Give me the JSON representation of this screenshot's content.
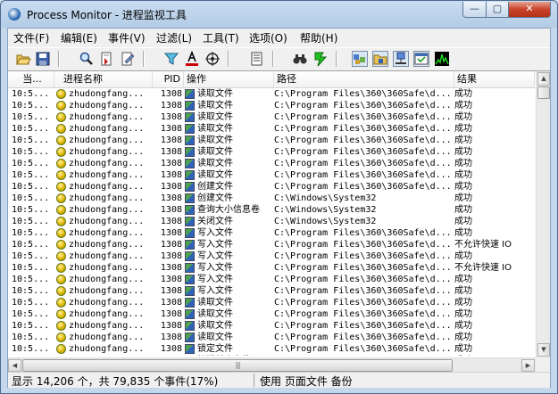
{
  "window": {
    "title": "Process Monitor - 进程监视工具"
  },
  "title_controls": {
    "minimize": "—",
    "maximize": "▢",
    "close": "✕"
  },
  "menu": [
    "文件(F)",
    "编辑(E)",
    "事件(V)",
    "过滤(L)",
    "工具(T)",
    "选项(O)",
    "帮助(H)"
  ],
  "columns": {
    "time": "当...",
    "process": "进程名称",
    "pid": "PID",
    "operation": "操作",
    "path": "路径",
    "result": "结果"
  },
  "rows": [
    {
      "time": "10:5...",
      "process": "zhudongfang...",
      "pid": "1308",
      "op": "读取文件",
      "path": "C:\\Program Files\\360\\360Safe\\d...",
      "result": "成功"
    },
    {
      "time": "10:5...",
      "process": "zhudongfang...",
      "pid": "1308",
      "op": "读取文件",
      "path": "C:\\Program Files\\360\\360Safe\\d...",
      "result": "成功"
    },
    {
      "time": "10:5...",
      "process": "zhudongfang...",
      "pid": "1308",
      "op": "读取文件",
      "path": "C:\\Program Files\\360\\360Safe\\d...",
      "result": "成功"
    },
    {
      "time": "10:5...",
      "process": "zhudongfang...",
      "pid": "1308",
      "op": "读取文件",
      "path": "C:\\Program Files\\360\\360Safe\\d...",
      "result": "成功"
    },
    {
      "time": "10:5...",
      "process": "zhudongfang...",
      "pid": "1308",
      "op": "读取文件",
      "path": "C:\\Program Files\\360\\360Safe\\d...",
      "result": "成功"
    },
    {
      "time": "10:5...",
      "process": "zhudongfang...",
      "pid": "1308",
      "op": "读取文件",
      "path": "C:\\Program Files\\360\\360Safe\\d...",
      "result": "成功"
    },
    {
      "time": "10:5...",
      "process": "zhudongfang...",
      "pid": "1308",
      "op": "读取文件",
      "path": "C:\\Program Files\\360\\360Safe\\d...",
      "result": "成功"
    },
    {
      "time": "10:5...",
      "process": "zhudongfang...",
      "pid": "1308",
      "op": "读取文件",
      "path": "C:\\Program Files\\360\\360Safe\\d...",
      "result": "成功"
    },
    {
      "time": "10:5...",
      "process": "zhudongfang...",
      "pid": "1308",
      "op": "创建文件",
      "path": "C:\\Program Files\\360\\360Safe\\d...",
      "result": "成功"
    },
    {
      "time": "10:5...",
      "process": "zhudongfang...",
      "pid": "1308",
      "op": "创建文件",
      "path": "C:\\Windows\\System32",
      "result": "成功"
    },
    {
      "time": "10:5...",
      "process": "zhudongfang...",
      "pid": "1308",
      "op": "查询大小信息卷",
      "path": "C:\\Windows\\System32",
      "result": "成功"
    },
    {
      "time": "10:5...",
      "process": "zhudongfang...",
      "pid": "1308",
      "op": "关闭文件",
      "path": "C:\\Windows\\System32",
      "result": "成功"
    },
    {
      "time": "10:5...",
      "process": "zhudongfang...",
      "pid": "1308",
      "op": "写入文件",
      "path": "C:\\Program Files\\360\\360Safe\\d...",
      "result": "成功"
    },
    {
      "time": "10:5...",
      "process": "zhudongfang...",
      "pid": "1308",
      "op": "写入文件",
      "path": "C:\\Program Files\\360\\360Safe\\d...",
      "result": "不允许快速 IO"
    },
    {
      "time": "10:5...",
      "process": "zhudongfang...",
      "pid": "1308",
      "op": "写入文件",
      "path": "C:\\Program Files\\360\\360Safe\\d...",
      "result": "成功"
    },
    {
      "time": "10:5...",
      "process": "zhudongfang...",
      "pid": "1308",
      "op": "写入文件",
      "path": "C:\\Program Files\\360\\360Safe\\d...",
      "result": "不允许快速 IO"
    },
    {
      "time": "10:5...",
      "process": "zhudongfang...",
      "pid": "1308",
      "op": "写入文件",
      "path": "C:\\Program Files\\360\\360Safe\\d...",
      "result": "成功"
    },
    {
      "time": "10:5...",
      "process": "zhudongfang...",
      "pid": "1308",
      "op": "写入文件",
      "path": "C:\\Program Files\\360\\360Safe\\d...",
      "result": "成功"
    },
    {
      "time": "10:5...",
      "process": "zhudongfang...",
      "pid": "1308",
      "op": "读取文件",
      "path": "C:\\Program Files\\360\\360Safe\\d...",
      "result": "成功"
    },
    {
      "time": "10:5...",
      "process": "zhudongfang...",
      "pid": "1308",
      "op": "读取文件",
      "path": "C:\\Program Files\\360\\360Safe\\d...",
      "result": "成功"
    },
    {
      "time": "10:5...",
      "process": "zhudongfang...",
      "pid": "1308",
      "op": "读取文件",
      "path": "C:\\Program Files\\360\\360Safe\\d...",
      "result": "成功"
    },
    {
      "time": "10:5...",
      "process": "zhudongfang...",
      "pid": "1308",
      "op": "读取文件",
      "path": "C:\\Program Files\\360\\360Safe\\d...",
      "result": "成功"
    },
    {
      "time": "10:5...",
      "process": "zhudongfang...",
      "pid": "1308",
      "op": "锁定文件",
      "path": "C:\\Program Files\\360\\360Safe\\d...",
      "result": "成功"
    },
    {
      "time": "10:5...",
      "process": "zhudongfang...",
      "pid": "1308",
      "op": "解锁单个文件",
      "path": "C:\\Program Files\\360\\360Safe\\d...",
      "result": "成功"
    }
  ],
  "statusbar": {
    "events": "显示 14,206 个，共 79,835 个事件(17%)",
    "backing": "使用 页面文件 备份"
  },
  "scrollbar": {
    "thumb_grip": "|||"
  },
  "icons": {
    "toolbar": [
      "open-icon",
      "save-icon",
      "find-icon",
      "autoscroll-icon",
      "clear-icon",
      "filter-icon",
      "highlight-icon",
      "target-icon",
      "process-tree-icon",
      "find-binoculars-icon",
      "jump-icon",
      "registry-activity-icon",
      "filesystem-activity-icon",
      "network-activity-icon",
      "process-activity-icon",
      "profiling-icon"
    ]
  },
  "colors": {
    "highlight_red": "#cc0000",
    "process_icon": "#e2b400"
  }
}
